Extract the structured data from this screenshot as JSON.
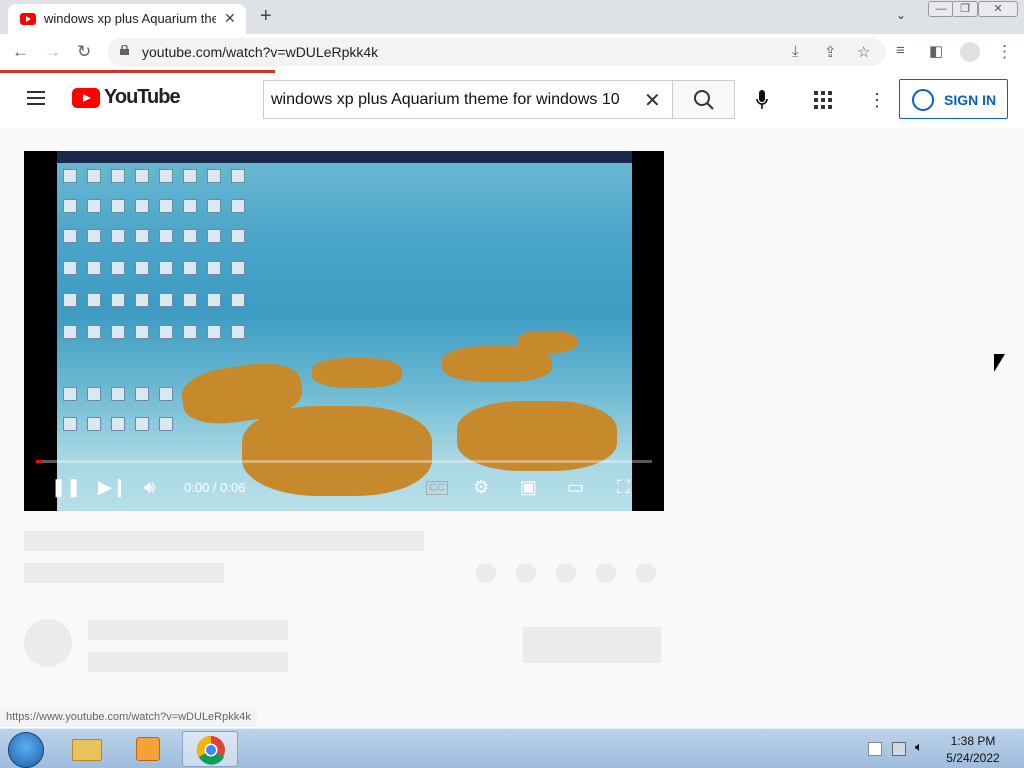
{
  "browser": {
    "tab_title": "windows xp plus Aquarium theme",
    "url": "youtube.com/watch?v=wDULeRpkk4k",
    "status_url": "https://www.youtube.com/watch?v=wDULeRpkk4k"
  },
  "youtube": {
    "logo_text": "YouTube",
    "search_query": "windows xp plus Aquarium theme for windows 10",
    "sign_in_label": "SIGN IN"
  },
  "player": {
    "time": "0:00 / 0:06",
    "progress": 0.01
  },
  "taskbar": {
    "time": "1:38 PM",
    "date": "5/24/2022"
  },
  "colors": {
    "accent_red": "#ff0000",
    "signin_blue": "#065fd4"
  }
}
